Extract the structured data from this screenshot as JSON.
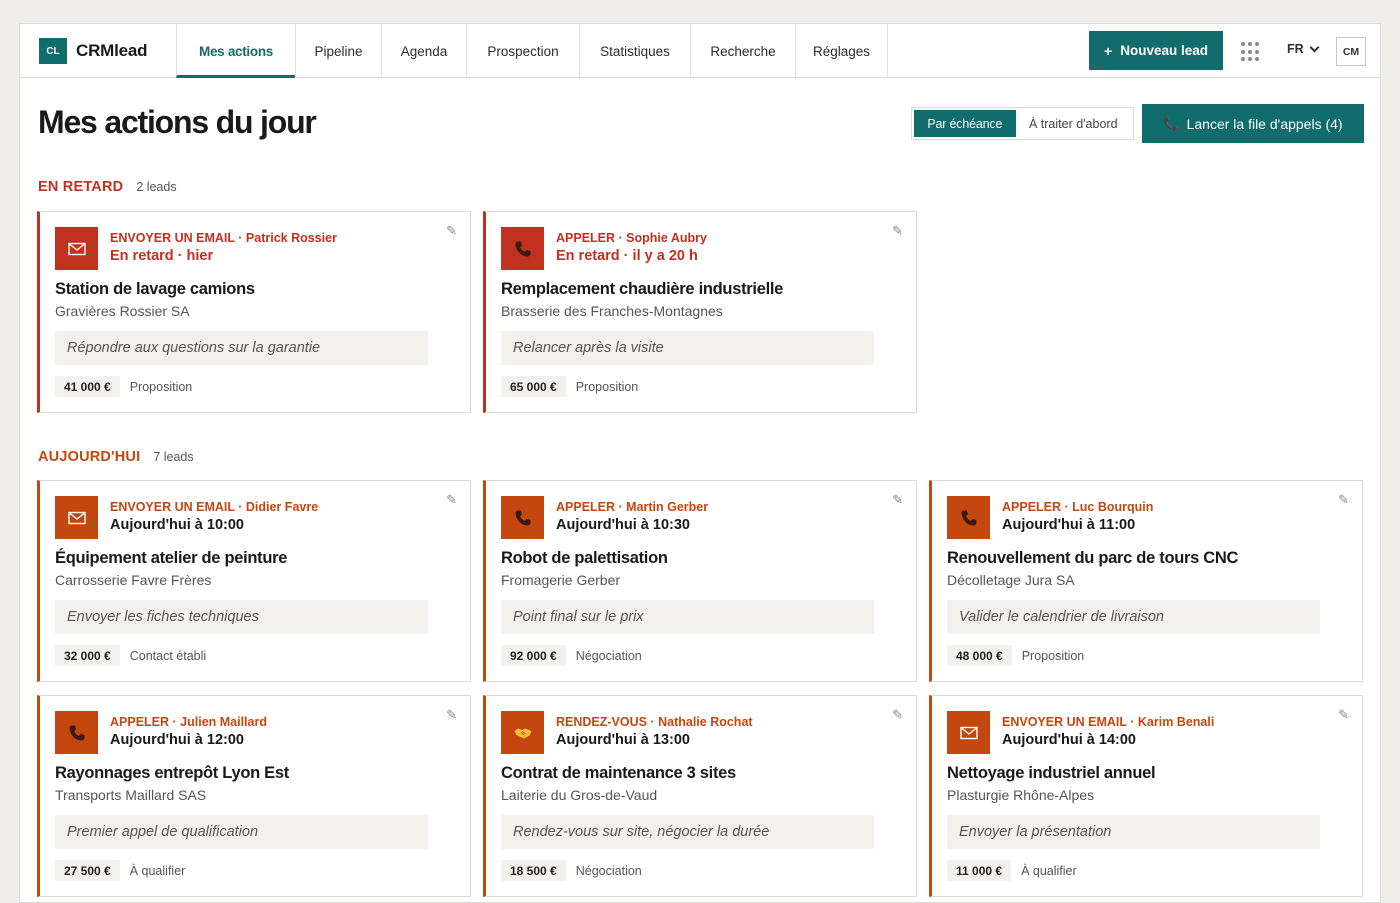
{
  "brand": {
    "logo": "CL",
    "name": "CRMlead"
  },
  "nav": {
    "tabs": [
      {
        "label": "Mes actions",
        "active": true
      },
      {
        "label": "Pipeline"
      },
      {
        "label": "Agenda"
      },
      {
        "label": "Prospection"
      },
      {
        "label": "Statistiques"
      },
      {
        "label": "Recherche"
      },
      {
        "label": "Réglages"
      }
    ]
  },
  "header": {
    "new_lead_label": "Nouveau lead",
    "new_lead_icon": "plus-icon",
    "apps_icon": "grid-icon",
    "language": "FR",
    "avatar_initials": "CM"
  },
  "page": {
    "title": "Mes actions du jour",
    "sort_options": [
      "Par échéance",
      "À traiter d'abord"
    ],
    "sort_active": "Par échéance",
    "call_queue_label": "Lancer la file d'appels (4)",
    "call_queue_icon": "phone-icon"
  },
  "colors": {
    "accent": "#116c6c",
    "late": "#c1311f",
    "today": "#c4470f"
  },
  "sections": [
    {
      "title": "EN RETARD",
      "count": "2 leads",
      "cards": [
        {
          "icon": "email-icon",
          "action": "ENVOYER UN EMAIL",
          "contact": "Patrick Rossier",
          "due": "En retard · hier",
          "title": "Station de lavage camions",
          "company": "Gravières Rossier SA",
          "note": "Répondre aux questions sur la garantie",
          "amount": "41 000 €",
          "stage": "Proposition"
        },
        {
          "icon": "phone-icon",
          "action": "APPELER",
          "contact": "Sophie Aubry",
          "due": "En retard · il y a 20 h",
          "title": "Remplacement chaudière industrielle",
          "company": "Brasserie des Franches-Montagnes",
          "note": "Relancer après la visite",
          "amount": "65 000 €",
          "stage": "Proposition"
        }
      ]
    },
    {
      "title": "AUJOURD'HUI",
      "count": "7 leads",
      "cards": [
        {
          "icon": "email-icon",
          "action": "ENVOYER UN EMAIL",
          "contact": "Didier Favre",
          "due": "Aujourd'hui à 10:00",
          "title": "Équipement atelier de peinture",
          "company": "Carrosserie Favre Frères",
          "note": "Envoyer les fiches techniques",
          "amount": "32 000 €",
          "stage": "Contact établi"
        },
        {
          "icon": "phone-icon",
          "action": "APPELER",
          "contact": "Martin Gerber",
          "due": "Aujourd'hui à 10:30",
          "title": "Robot de palettisation",
          "company": "Fromagerie Gerber",
          "note": "Point final sur le prix",
          "amount": "92 000 €",
          "stage": "Négociation"
        },
        {
          "icon": "phone-icon",
          "action": "APPELER",
          "contact": "Luc Bourquin",
          "due": "Aujourd'hui à 11:00",
          "title": "Renouvellement du parc de tours CNC",
          "company": "Décolletage Jura SA",
          "note": "Valider le calendrier de livraison",
          "amount": "48 000 €",
          "stage": "Proposition"
        },
        {
          "icon": "phone-icon",
          "action": "APPELER",
          "contact": "Julien Maillard",
          "due": "Aujourd'hui à 12:00",
          "title": "Rayonnages entrepôt Lyon Est",
          "company": "Transports Maillard SAS",
          "note": "Premier appel de qualification",
          "amount": "27 500 €",
          "stage": "À qualifier"
        },
        {
          "icon": "handshake-icon",
          "action": "RENDEZ-VOUS",
          "contact": "Nathalie Rochat",
          "due": "Aujourd'hui à 13:00",
          "title": "Contrat de maintenance 3 sites",
          "company": "Laiterie du Gros-de-Vaud",
          "note": "Rendez-vous sur site, négocier la durée",
          "amount": "18 500 €",
          "stage": "Négociation"
        },
        {
          "icon": "email-icon",
          "action": "ENVOYER UN EMAIL",
          "contact": "Karim Benali",
          "due": "Aujourd'hui à 14:00",
          "title": "Nettoyage industriel annuel",
          "company": "Plasturgie Rhône-Alpes",
          "note": "Envoyer la présentation",
          "amount": "11 000 €",
          "stage": "À qualifier"
        }
      ]
    }
  ]
}
